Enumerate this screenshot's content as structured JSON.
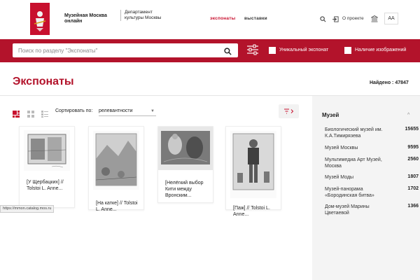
{
  "header": {
    "brand": "Музейная Москва онлайн",
    "department": "Департамент культуры Москвы",
    "nav": [
      "экспонаты",
      "выставки"
    ],
    "about": "О проекте",
    "font_size_toggle": "АА"
  },
  "search": {
    "placeholder": "Поиск по разделу \"Экспонаты\"",
    "unique_label": "Уникальный экспонат",
    "images_label": "Наличие изображений"
  },
  "page": {
    "title": "Экспонаты",
    "found": "Найдено : 47847"
  },
  "toolbar": {
    "sort_label": "Сортировать по:",
    "sort_value": "релевантности"
  },
  "cards": [
    {
      "caption": "[У Щербацких] // Tolstoi L. Anne..."
    },
    {
      "caption": "[На катке] // Tolstoi L. Anne..."
    },
    {
      "caption": "[Нелёгкий выбор Кити между Вронским..."
    },
    {
      "caption": "[Паж] // Tolstoi L. Anne..."
    }
  ],
  "sidebar": {
    "heading": "Музей",
    "items": [
      {
        "name": "Биологический музей им. К.А.Тимирязева",
        "count": "15655"
      },
      {
        "name": "Музей Москвы",
        "count": "9595"
      },
      {
        "name": "Мультимедиа Арт Музей, Москва",
        "count": "2560"
      },
      {
        "name": "Музей Моды",
        "count": "1807"
      },
      {
        "name": "Музей-панорама «Бородинская битва»",
        "count": "1702"
      },
      {
        "name": "Дом-музей Марины Цветаевой",
        "count": "1366"
      }
    ]
  },
  "status_url": "https://mmon.catalog.mos.ru",
  "colors": {
    "accent": "#b3132b",
    "brand_red": "#c8102e"
  }
}
